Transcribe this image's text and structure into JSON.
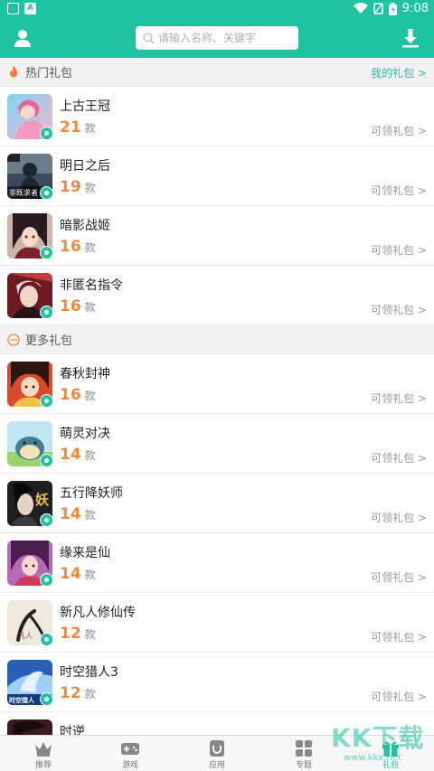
{
  "status_bar": {
    "time": "9:08"
  },
  "header": {
    "search_placeholder": "请输入名称、关键字"
  },
  "hot_section": {
    "title": "热门礼包",
    "my_gift_link": "我的礼包 >"
  },
  "more_section": {
    "title": "更多礼包"
  },
  "claim_label": "可领礼包 >",
  "unit_label": "款",
  "hot_games": [
    {
      "name": "上古王冠",
      "count": "21"
    },
    {
      "name": "明日之后",
      "count": "19"
    },
    {
      "name": "暗影战姬",
      "count": "16"
    },
    {
      "name": "非匿名指令",
      "count": "16"
    }
  ],
  "more_games": [
    {
      "name": "春秋封神",
      "count": "16"
    },
    {
      "name": "萌灵对决",
      "count": "14"
    },
    {
      "name": "五行降妖师",
      "count": "14"
    },
    {
      "name": "缘来是仙",
      "count": "14"
    },
    {
      "name": "新凡人修仙传",
      "count": "12"
    },
    {
      "name": "时空猎人3",
      "count": "12"
    },
    {
      "name": "时逆",
      "count": ""
    }
  ],
  "thumb_text": {
    "mingri": "非既求者",
    "wuxing": "妖",
    "fanren": "凡人",
    "shikong": "时空猎人"
  },
  "bottom_nav": [
    {
      "label": "推荐",
      "icon": "crown-icon"
    },
    {
      "label": "游戏",
      "icon": "gamepad-icon"
    },
    {
      "label": "应用",
      "icon": "app-icon"
    },
    {
      "label": "专题",
      "icon": "grid-icon"
    },
    {
      "label": "礼包",
      "icon": "gift-icon"
    }
  ],
  "watermark": {
    "text": "KK下载",
    "url": "www.kkx.net"
  },
  "colors": {
    "accent": "#20c3a1",
    "count": "#ef8a3c"
  }
}
